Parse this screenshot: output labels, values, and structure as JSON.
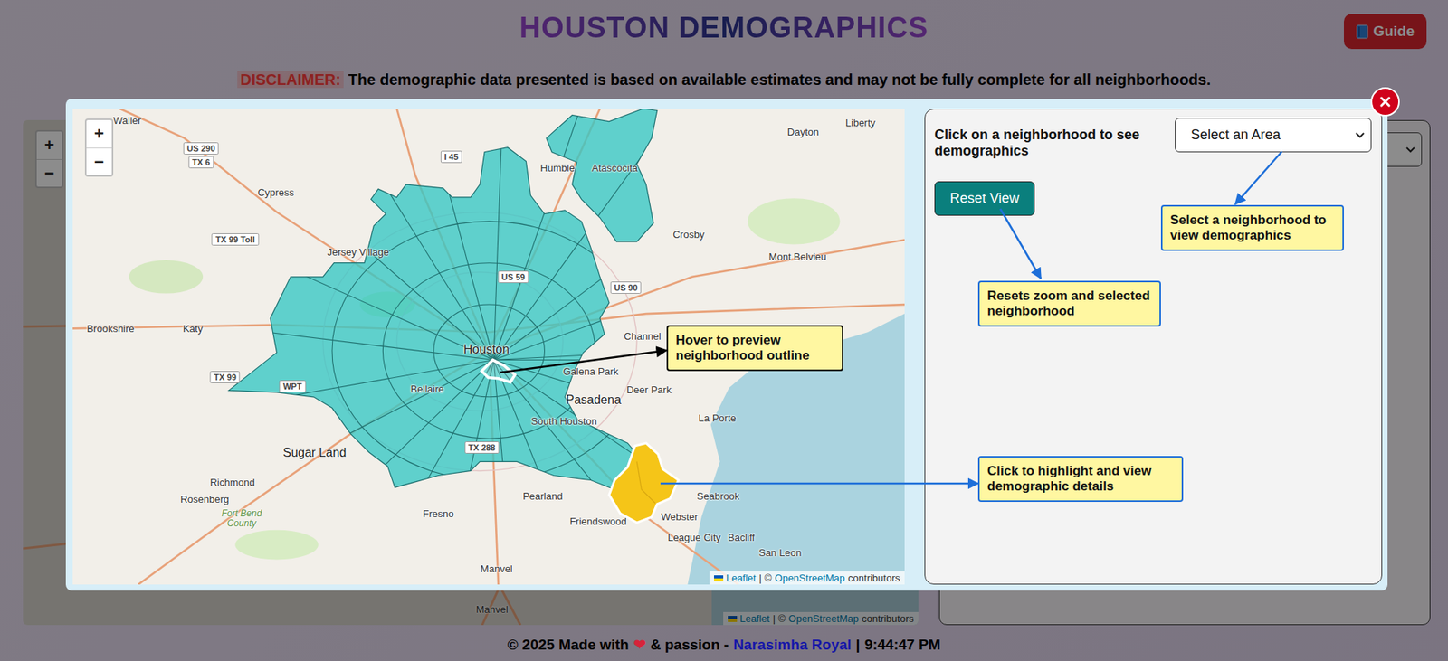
{
  "header": {
    "title": "HOUSTON DEMOGRAPHICS",
    "guide_button": "Guide"
  },
  "disclaimer": {
    "label": "DISCLAIMER:",
    "text": "The demographic data presented is based on available estimates and may not be fully complete for all neighborhoods."
  },
  "background": {
    "zoom_in": "+",
    "zoom_out": "−",
    "labels": [
      "Manvel"
    ],
    "attribution": {
      "leaflet": "Leaflet",
      "middle": "| ©",
      "osm": "OpenStreetMap",
      "end": "contributors"
    }
  },
  "guide": {
    "map": {
      "zoom_in": "+",
      "zoom_out": "−",
      "labels": [
        {
          "text": "Waller",
          "kind": "town"
        },
        {
          "text": "Cypress",
          "kind": "town"
        },
        {
          "text": "Jersey Village",
          "kind": "town"
        },
        {
          "text": "Brookshire",
          "kind": "town"
        },
        {
          "text": "Katy",
          "kind": "town"
        },
        {
          "text": "Humble",
          "kind": "town"
        },
        {
          "text": "Atascocita",
          "kind": "town"
        },
        {
          "text": "Dayton",
          "kind": "town"
        },
        {
          "text": "Liberty",
          "kind": "town"
        },
        {
          "text": "Crosby",
          "kind": "town"
        },
        {
          "text": "Mont Belvieu",
          "kind": "town"
        },
        {
          "text": "Houston",
          "kind": "city"
        },
        {
          "text": "Channel",
          "kind": "town"
        },
        {
          "text": "Galena Park",
          "kind": "town"
        },
        {
          "text": "Bellaire",
          "kind": "town"
        },
        {
          "text": "Pasadena",
          "kind": "city"
        },
        {
          "text": "Deer Park",
          "kind": "town"
        },
        {
          "text": "South Houston",
          "kind": "town"
        },
        {
          "text": "La Porte",
          "kind": "town"
        },
        {
          "text": "Sugar Land",
          "kind": "city"
        },
        {
          "text": "Richmond",
          "kind": "town"
        },
        {
          "text": "Rosenberg",
          "kind": "town"
        },
        {
          "text": "Fort Bend County",
          "kind": "county"
        },
        {
          "text": "Fresno",
          "kind": "town"
        },
        {
          "text": "Pearland",
          "kind": "town"
        },
        {
          "text": "Friendswood",
          "kind": "town"
        },
        {
          "text": "Webster",
          "kind": "town"
        },
        {
          "text": "Seabrook",
          "kind": "town"
        },
        {
          "text": "League City",
          "kind": "town"
        },
        {
          "text": "Bacliff",
          "kind": "town"
        },
        {
          "text": "San Leon",
          "kind": "town"
        },
        {
          "text": "Manvel",
          "kind": "town"
        },
        {
          "text": "US 290",
          "kind": "shield"
        },
        {
          "text": "TX 6",
          "kind": "shield"
        },
        {
          "text": "I 45",
          "kind": "shield"
        },
        {
          "text": "TX 99 Toll",
          "kind": "shield"
        },
        {
          "text": "US 59",
          "kind": "shield"
        },
        {
          "text": "US 90",
          "kind": "shield"
        },
        {
          "text": "TX 99",
          "kind": "shield"
        },
        {
          "text": "WPT",
          "kind": "shield"
        },
        {
          "text": "TX 288",
          "kind": "shield"
        }
      ],
      "attribution": {
        "leaflet": "Leaflet",
        "middle": "| ©",
        "osm": "OpenStreetMap",
        "end": "contributors"
      }
    },
    "panel": {
      "instruction": "Click on a neighborhood to see demographics",
      "select": "Select an Area",
      "reset_button": "Reset View"
    },
    "callouts": [
      {
        "text": "Hover to preview neighborhood outline",
        "color": "#000000"
      },
      {
        "text": "Click to highlight and view demographic details",
        "color": "#1e6fd9"
      },
      {
        "text": "Resets zoom and selected neighborhood",
        "color": "#1e6fd9"
      },
      {
        "text": "Select a neighborhood to view demographics",
        "color": "#1e6fd9"
      }
    ]
  },
  "footer": {
    "copyright": "© 2025 Made with",
    "heart": "❤",
    "passion": "& passion -",
    "author": "Narasimha Royal",
    "separator": "|",
    "time": "9:44:47 PM"
  }
}
